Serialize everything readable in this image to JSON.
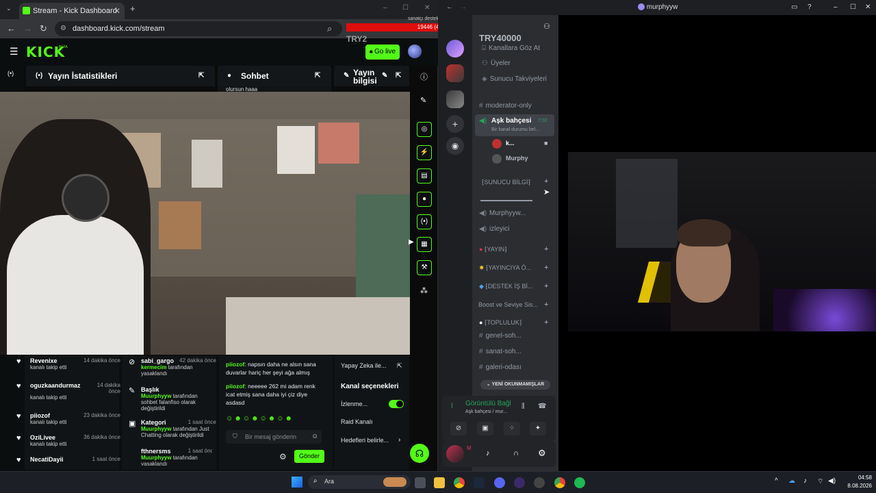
{
  "browser": {
    "tab_title": "Stream - Kick Dashboard",
    "url": "dashboard.kick.com/stream",
    "new_tab": "+",
    "window_controls": [
      "–",
      "☐",
      "✕"
    ]
  },
  "overlay": {
    "small_label": "sanatçı destekle",
    "goal_value": "19446 (4.86%)",
    "try2": "TRY2",
    "try40000": "TRY40000"
  },
  "kick": {
    "logo": "KICK",
    "beta": "BETA",
    "go_live": "Go live",
    "panels": {
      "stats": "Yayın İstatistikleri",
      "chat": "Sohbet",
      "info": "Yayın bilgisi"
    },
    "chat_snippet": "olursun haaa"
  },
  "followers": [
    {
      "name": "Revenixe",
      "action": "kanalı takip etti",
      "time": "14 dakika önce"
    },
    {
      "name": "oguzkaandurmaz",
      "action": "kanalı takip etti",
      "time": "14 dakika önce"
    },
    {
      "name": "piiozof",
      "action": "kanalı takip etti",
      "time": "23 dakika önce"
    },
    {
      "name": "OziLivee",
      "action": "kanalı takip etti",
      "time": "36 dakika önce"
    },
    {
      "name": "NecatiDayii",
      "action": "",
      "time": "1 saat önce"
    }
  ],
  "events": [
    {
      "name": "sabi_gargo",
      "time": "42 dakika önce",
      "g": "kermecim",
      "text": "tarafından yasaklandı"
    },
    {
      "name": "Başlık",
      "time": "",
      "g": "Muurphyyw",
      "text": "tarafından sohbet falanfiso olarak değiştirildi"
    },
    {
      "name": "Kategori",
      "time": "1 saat önce",
      "g": "Muurphyyw",
      "text": "tarafından Just Chatting olarak değiştirildi"
    },
    {
      "name": "fthnersms",
      "time": "1 saat önce",
      "g": "Muurphyyw",
      "text": "tarafından yasaklandı"
    }
  ],
  "chat": {
    "messages": [
      {
        "user": "piiozof",
        "text": "napsın daha ne alsın sana duvarlar hariç her şeyi ağa almış"
      },
      {
        "user": "piiozof",
        "text": "neeeee 262 mi adam renk icat etmiş sana daha iyi çiz diye asdasd"
      }
    ],
    "placeholder": "Bir mesaj gönderin",
    "send": "Gönder"
  },
  "channel_panel": {
    "ai": "Yapay Zeka ile...",
    "title": "Kanal seçenekleri",
    "viewers": "İzlenme...",
    "raid": "Raid Kanalı",
    "goals": "Hedefleri belirle..."
  },
  "discord": {
    "window_title": "murphyyw",
    "server_name": "TRY40000",
    "nav": [
      "Kanallara Göz At",
      "Üyeler",
      "Sunucu Takviyeleri"
    ],
    "channels": [
      {
        "name": "moderator-only",
        "kind": "text"
      },
      {
        "name": "Aşk bahçesi",
        "kind": "voice",
        "timer": "7:02",
        "status": "Bir kanal durumu bel..."
      }
    ],
    "voice_users": [
      "k...",
      "Murphy"
    ],
    "categories": [
      {
        "name": "⁅SUNUCU BİLGİ⁆"
      },
      {
        "name": "⁅YAYIN⁆"
      },
      {
        "name": "⁅YAYINCIYA Ö..."
      },
      {
        "name": "⁅DESTEK İŞ Bİ..."
      },
      {
        "name": "Boost ve Seviye Sis..."
      },
      {
        "name": "⁅TOPLULUK⁆"
      }
    ],
    "info_voice": [
      "Murphyyw...",
      "izleyici"
    ],
    "community_channels": [
      "genel-soh...",
      "sanat-soh...",
      "galeri-odası"
    ],
    "unread": "YENİ OKUNMAMIŞLAR",
    "voice_connected": "Görüntülü Bağl",
    "voice_sub": "Aşk bahçesi / mur...",
    "user_initial": "M"
  },
  "taskbar": {
    "search": "Ara",
    "time": "04:58",
    "date": "8.08.2026",
    "chevron": "^"
  },
  "colors": {
    "kick_green": "#53fc18",
    "discord_bg": "#2b2d31",
    "danger_red": "#e00d0d"
  }
}
